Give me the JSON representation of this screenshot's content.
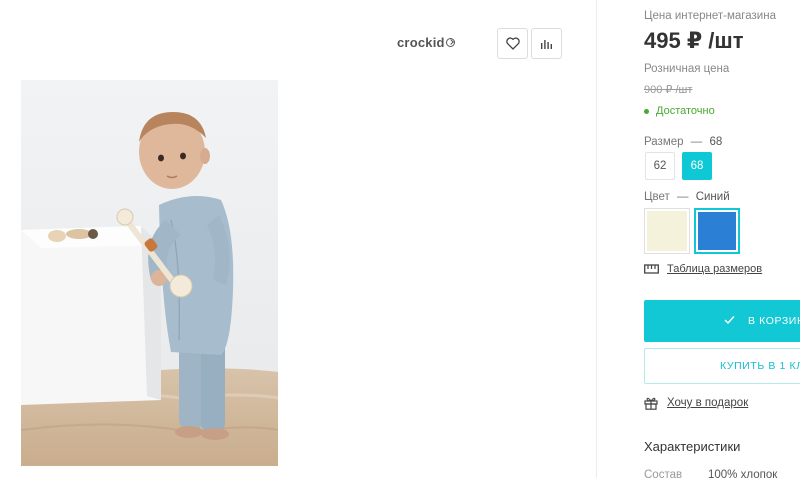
{
  "brand": {
    "name": "crockid"
  },
  "actions": {
    "favorite_icon": "heart-icon",
    "compare_icon": "bar-chart-icon"
  },
  "product_image": {
    "description_icon": "baby-photo"
  },
  "price": {
    "caption": "Цена интернет-магазина",
    "value": "495 ₽ /шт",
    "retail_caption": "Розничная цена",
    "retail_value": "900 ₽ /шт"
  },
  "stock": {
    "label": "Достаточно",
    "color": "#49a832"
  },
  "size": {
    "label": "Размер",
    "separator": "—",
    "selected": "68",
    "options": [
      "62",
      "68"
    ]
  },
  "color": {
    "label": "Цвет",
    "separator": "—",
    "selected": "Синий",
    "swatches": [
      "#f5f2dc",
      "#2b80d6"
    ]
  },
  "size_table": {
    "label": "Таблица размеров"
  },
  "buttons": {
    "cart": "В КОРЗИН",
    "buy_one_click": "КУПИТЬ В 1 КЛ",
    "accent": "#13c8d5"
  },
  "gift": {
    "label": "Хочу в подарок"
  },
  "characteristics": {
    "title": "Характеристики",
    "rows": [
      {
        "name": "Состав",
        "value": "100% хлопок"
      }
    ]
  }
}
